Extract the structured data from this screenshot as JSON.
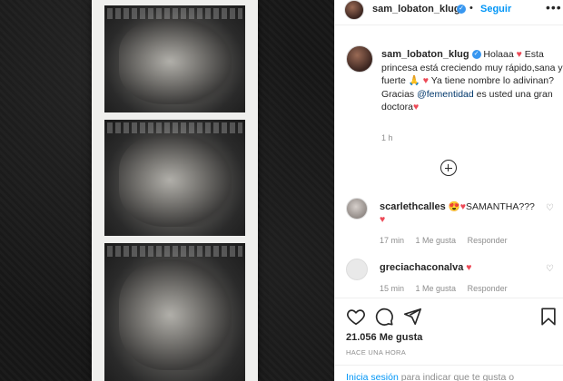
{
  "post": {
    "username": "sam_lobaton_klug",
    "follow_label": "Seguir",
    "separator": "•",
    "more": "•••",
    "caption_parts": {
      "greeting": "Holaaa",
      "line1": "Esta princesa está creciendo muy rápido,sana y fuerte",
      "line2": "Ya tiene nombre lo adivinan?",
      "line3_prefix": "Gracias",
      "mention": "@fementidad",
      "line3_suffix": "es usted una gran doctora"
    },
    "caption_time": "1 h",
    "comments": [
      {
        "username": "scarlethcalles",
        "text": "SAMANTHA???",
        "time": "17 min",
        "likes": "1 Me gusta",
        "reply": "Responder"
      },
      {
        "username": "greciachaconalva",
        "text": "",
        "time": "15 min",
        "likes": "1 Me gusta",
        "reply": "Responder"
      }
    ],
    "likes_count": "21.056 Me gusta",
    "posted_ago": "HACE UNA HORA",
    "login_prompt": {
      "link": "Inicia sesión",
      "text": "para indicar que te gusta o"
    }
  },
  "icons": {
    "verified": "verified-badge-icon",
    "heart": "heart-icon",
    "comment": "comment-icon",
    "share": "share-icon",
    "save": "bookmark-icon",
    "load_more": "plus-circle-icon"
  },
  "colors": {
    "accent": "#0095f6",
    "verified": "#3897f0",
    "heart": "#ed4956",
    "secondary_text": "#8e8e8e"
  }
}
